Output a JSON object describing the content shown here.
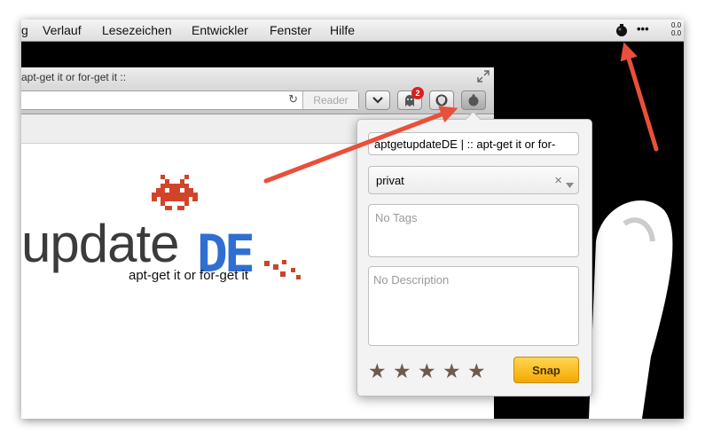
{
  "menubar": {
    "items": [
      "g",
      "Verlauf",
      "Lesezeichen",
      "Entwickler",
      "Fenster",
      "Hilfe"
    ],
    "extension_icon": "bomb-icon",
    "more_label": "•••",
    "readout_top": "0.0",
    "readout_bottom": "0.0"
  },
  "browser": {
    "window_title": "apt-get it or for-get it ::",
    "reader_label": "Reader",
    "badge_count": "2"
  },
  "page": {
    "logo_text": "update",
    "logo_suffix": "DE",
    "tagline": "apt-get it or for-get it"
  },
  "popover": {
    "title_value": "aptgetupdateDE | :: apt-get it or for-",
    "folder_value": "privat",
    "clear_symbol": "×",
    "tags_placeholder": "No Tags",
    "description_placeholder": "No Description",
    "rating": 0,
    "star_glyph": "★",
    "snap_label": "Snap"
  },
  "colors": {
    "accent": "#f5a800",
    "arrow": "#e8503a",
    "star": "#6f5a4a",
    "logo_blue": "#2f6fd1"
  }
}
